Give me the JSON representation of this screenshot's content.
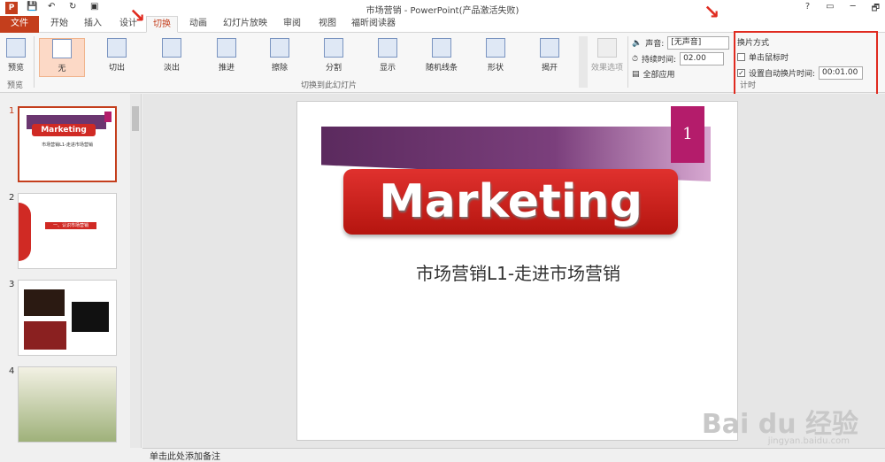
{
  "window": {
    "title": "市场营销 - PowerPoint(产品激活失败)",
    "help": "?",
    "restore": "▭",
    "minimize": "─",
    "maximize": "🗗"
  },
  "tabs": [
    "文件",
    "开始",
    "插入",
    "设计",
    "切换",
    "动画",
    "幻灯片放映",
    "审阅",
    "视图",
    "福昕阅读器"
  ],
  "ribbon": {
    "preview_label": "预览",
    "preview_group": "预览",
    "transitions_group": "切换到此幻灯片",
    "transitions": [
      "无",
      "切出",
      "淡出",
      "推进",
      "擦除",
      "分割",
      "显示",
      "随机线条",
      "形状",
      "揭开"
    ],
    "effect_options": "效果选项",
    "sound_label": "声音:",
    "sound_value": "[无声音]",
    "duration_label": "持续时间:",
    "duration_value": "02.00",
    "apply_all": "全部应用",
    "advance_title": "换片方式",
    "on_click": "单击鼠标时",
    "auto_after": "设置自动换片时间:",
    "auto_time": "00:01.00",
    "timing_group": "计时"
  },
  "slides_panel": {
    "numbers": [
      "1",
      "2",
      "3",
      "4"
    ],
    "thumb1_title": "Marketing",
    "thumb1_sub": "市场营销L1-走进市场营销",
    "thumb2_text": "一、认识市场营销"
  },
  "slide": {
    "number": "1",
    "title": "Marketing",
    "subtitle": "市场营销L1-走进市场营销"
  },
  "notes": "单击此处添加备注",
  "watermark": "Bai du 经验",
  "watermark_url": "jingyan.baidu.com"
}
